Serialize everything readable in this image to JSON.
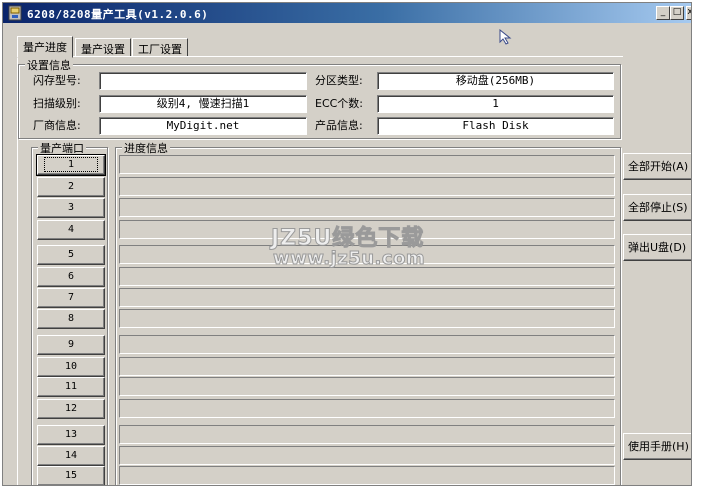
{
  "window": {
    "title": "6208/8208量产工具(v1.2.0.6)",
    "controls": {
      "minimize": "_",
      "maximize": "□",
      "close": "x"
    }
  },
  "tabs": [
    {
      "label": "量产进度",
      "active": true
    },
    {
      "label": "量产设置",
      "active": false
    },
    {
      "label": "工厂设置",
      "active": false
    }
  ],
  "settings": {
    "group_title": "设置信息",
    "flash_model": {
      "label": "闪存型号:",
      "value": ""
    },
    "partition_type": {
      "label": "分区类型:",
      "value": "移动盘(256MB)"
    },
    "scan_level": {
      "label": "扫描级别:",
      "value": "级别4, 慢速扫描1"
    },
    "ecc_count": {
      "label": "ECC个数:",
      "value": "1"
    },
    "vendor_info": {
      "label": "厂商信息:",
      "value": "MyDigit.net"
    },
    "product_info": {
      "label": "产品信息:",
      "value": "Flash Disk"
    }
  },
  "ports": {
    "group_title": "量产端口",
    "items": [
      "1",
      "2",
      "3",
      "4",
      "5",
      "6",
      "7",
      "8",
      "9",
      "10",
      "11",
      "12",
      "13",
      "14",
      "15"
    ]
  },
  "progress": {
    "group_title": "进度信息"
  },
  "actions": {
    "start_all": "全部开始(A)",
    "stop_all": "全部停止(S)",
    "eject_udisk": "弹出U盘(D)",
    "manual": "使用手册(H)"
  },
  "watermark": {
    "line1": "JZ5U绿色下载",
    "line2": "www.jz5u.com"
  },
  "colors": {
    "face": "#d4d0c8",
    "title_active_start": "#0a246a",
    "title_active_end": "#a6caf0",
    "field_bg": "#ffffff"
  }
}
